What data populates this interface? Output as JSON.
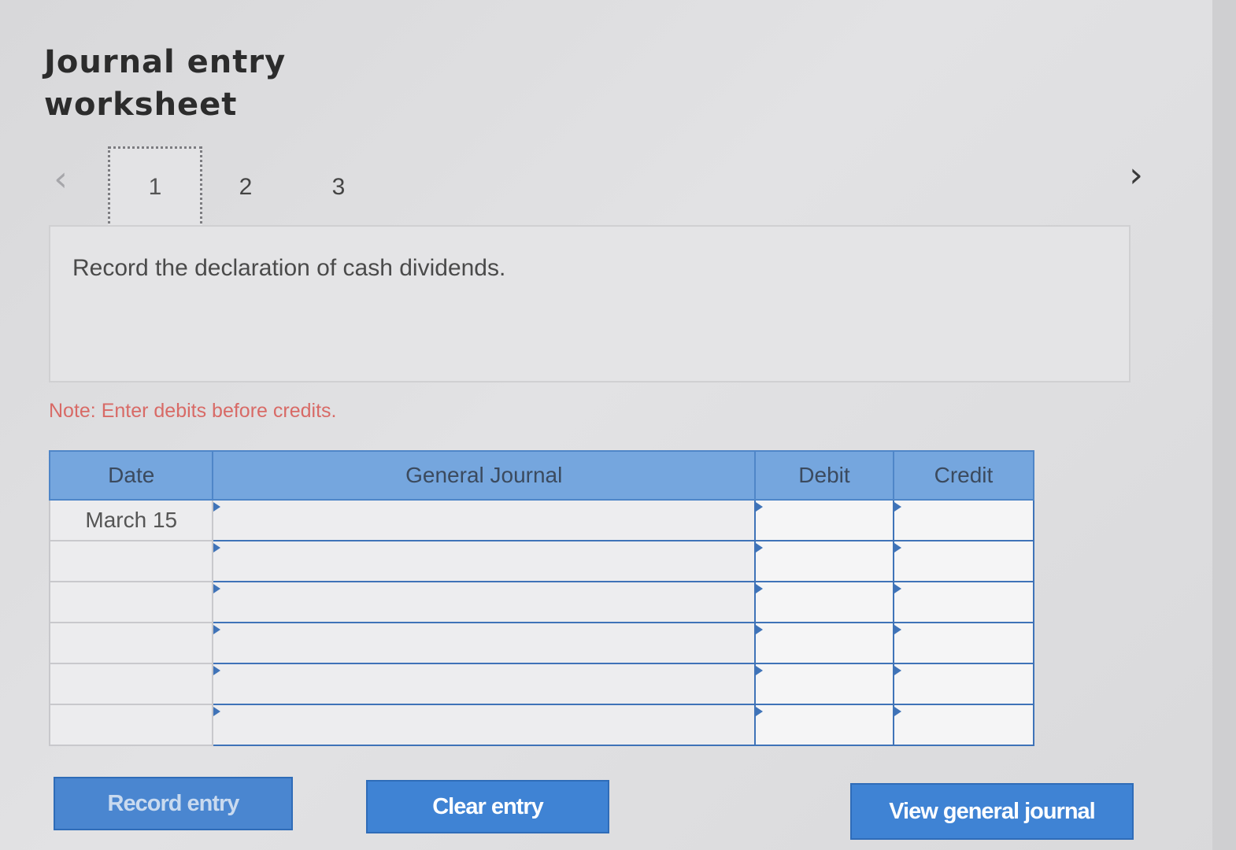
{
  "page": {
    "title_line1": "Journal entry",
    "title_line2": "worksheet"
  },
  "nav": {
    "prev_icon": "chevron-left-icon",
    "next_icon": "chevron-right-icon",
    "prev_glyph": "‹",
    "next_glyph": "›",
    "tabs": [
      {
        "label": "1",
        "active": true
      },
      {
        "label": "2",
        "active": false
      },
      {
        "label": "3",
        "active": false
      }
    ]
  },
  "question": {
    "text": "Record the declaration of cash dividends."
  },
  "note": "Note: Enter debits before credits.",
  "journal": {
    "headers": {
      "date": "Date",
      "general_journal": "General Journal",
      "debit": "Debit",
      "credit": "Credit"
    },
    "rows": [
      {
        "date": "March 15",
        "account": "",
        "debit": "",
        "credit": ""
      },
      {
        "date": "",
        "account": "",
        "debit": "",
        "credit": ""
      },
      {
        "date": "",
        "account": "",
        "debit": "",
        "credit": ""
      },
      {
        "date": "",
        "account": "",
        "debit": "",
        "credit": ""
      },
      {
        "date": "",
        "account": "",
        "debit": "",
        "credit": ""
      },
      {
        "date": "",
        "account": "",
        "debit": "",
        "credit": ""
      }
    ]
  },
  "buttons": {
    "record": "Record entry",
    "clear": "Clear entry",
    "view": "View general journal"
  },
  "colors": {
    "header_blue": "#75a6de",
    "button_blue": "#3f83d4",
    "note_red": "#d86a66"
  }
}
